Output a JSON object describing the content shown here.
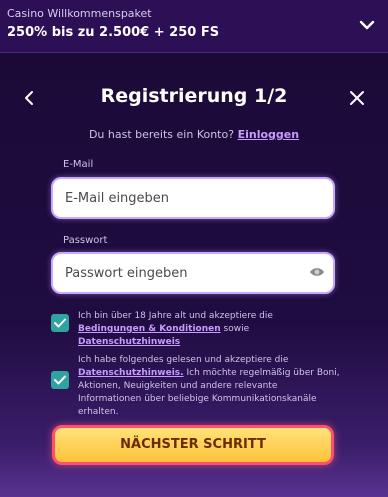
{
  "promo": {
    "subtitle": "Casino Willkommenspaket",
    "title": "250% bis zu 2.500€ + 250 FS"
  },
  "modal": {
    "heading": "Registrierung 1/2",
    "login_prompt": "Du hast bereits ein Konto?",
    "login_link": "Einloggen"
  },
  "form": {
    "email_label": "E-Mail",
    "email_placeholder": "E-Mail eingeben",
    "email_value": "",
    "password_label": "Passwort",
    "password_placeholder": "Passwort eingeben",
    "password_value": ""
  },
  "consents": [
    {
      "checked": true,
      "text_before": "Ich bin über 18 Jahre alt und akzeptiere die",
      "link1": "Bedingungen & Konditionen",
      "text_middle": "sowie",
      "link2": "Datenschutzhinweis"
    },
    {
      "checked": true,
      "text_before": "Ich habe folgendes gelesen und akzeptiere die",
      "link1": "Datenschutzhinweis.",
      "text_after": "Ich möchte regelmäßig über Boni, Aktionen, Neuigkeiten und andere relevante Informationen über beliebige Kommunikationskanäle erhalten."
    }
  ],
  "cta": {
    "label": "NÄCHSTER SCHRITT"
  },
  "icons": {
    "promo_toggle": "chevron-down-icon",
    "back": "chevron-left-icon",
    "close": "close-icon",
    "password_visibility": "eye-icon",
    "checkbox": "check-icon"
  },
  "colors": {
    "background": "#1d0c3e",
    "accent_link": "#c89cff",
    "checkbox": "#2fa3a0",
    "cta_fill": "#ffc23a",
    "cta_border": "#ff4f6e"
  }
}
